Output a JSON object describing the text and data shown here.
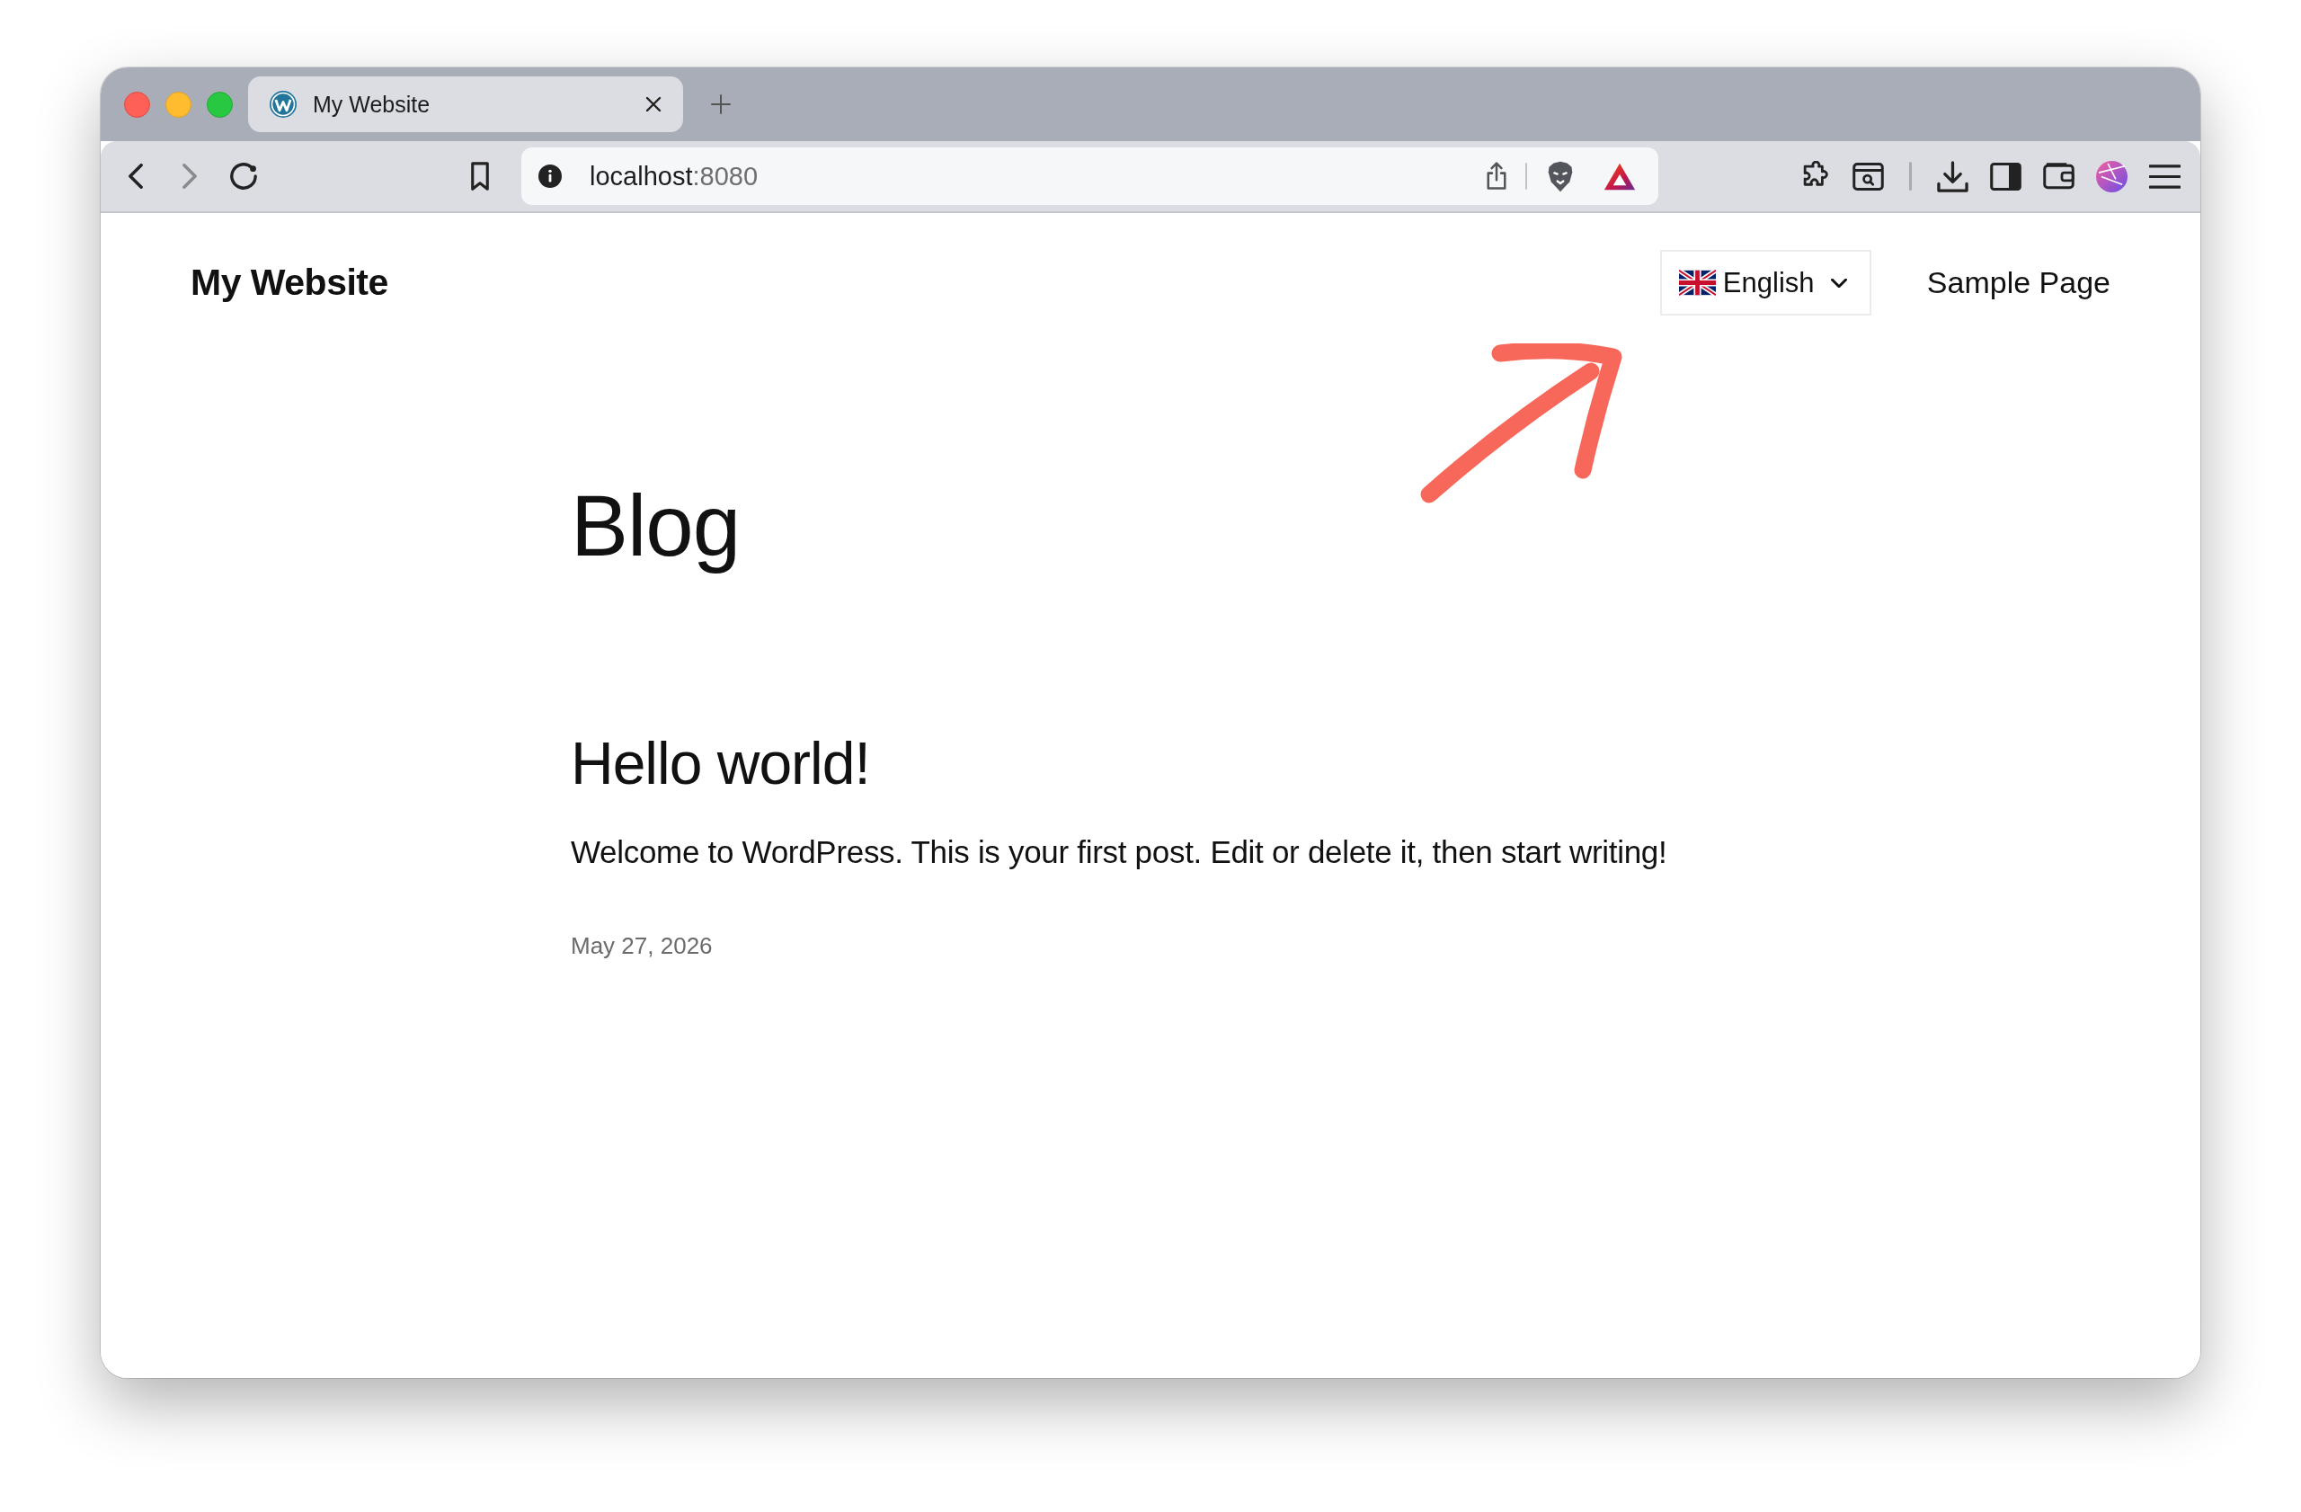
{
  "browser": {
    "tabs": [
      {
        "title": "My Website",
        "selected": true
      }
    ],
    "address_bar": {
      "host": "localhost",
      "port": ":8080"
    }
  },
  "site_header": {
    "title": "My Website",
    "language_switcher": {
      "label": "English"
    },
    "nav": [
      {
        "label": "Sample Page"
      }
    ]
  },
  "page": {
    "title": "Blog",
    "posts": [
      {
        "title": "Hello world!",
        "excerpt": "Welcome to WordPress. This is your first post. Edit or delete it, then start writing!",
        "date": "May 27, 2026"
      }
    ]
  }
}
